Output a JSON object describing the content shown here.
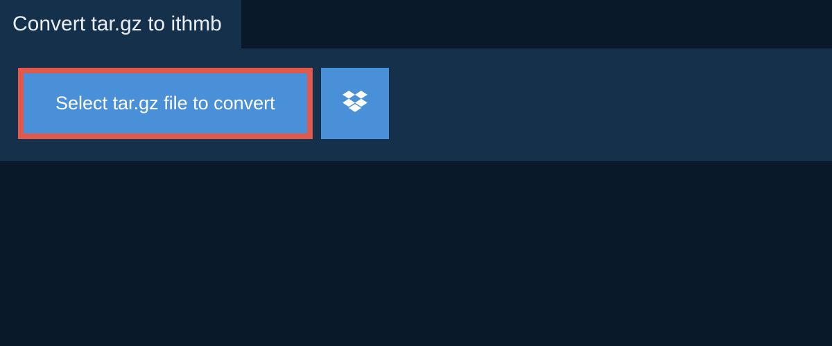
{
  "header": {
    "title": "Convert tar.gz to ithmb"
  },
  "actions": {
    "select_file_label": "Select tar.gz file to convert"
  },
  "colors": {
    "background": "#0a1929",
    "panel": "#15304a",
    "button": "#4a90d9",
    "highlight_border": "#e0594a",
    "text_light": "#e8eef4",
    "text_white": "#ffffff"
  }
}
